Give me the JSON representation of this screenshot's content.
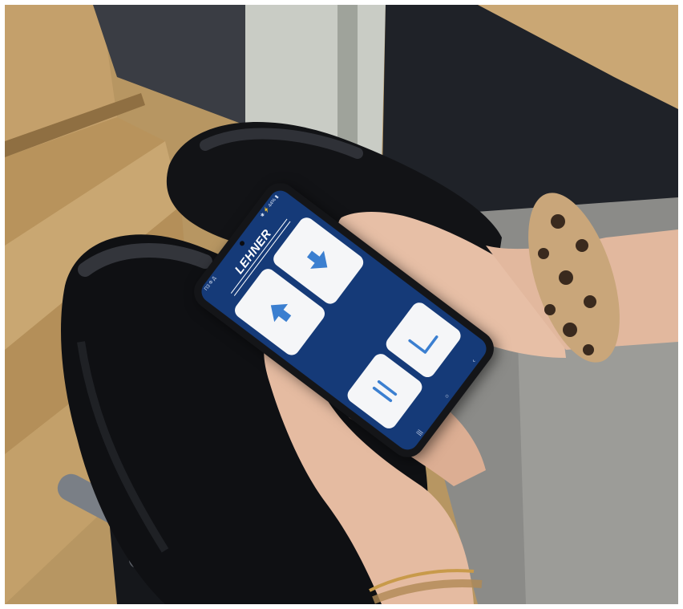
{
  "photo": {
    "description_free": true
  },
  "phone": {
    "status_left": "ПЗ Ф Д",
    "status_right": "✱ ⚡ 44% ▮",
    "logo_text": "LEHNER",
    "keys": {
      "up_icon": "arrow-up-icon",
      "down_icon": "arrow-down-icon",
      "stand_icon": "standing-posture-icon",
      "sit_icon": "sitting-posture-icon"
    },
    "nav": {
      "recents": "|||",
      "home": "○",
      "back": "‹"
    }
  },
  "colors": {
    "screen": "#153a78",
    "key": "#f5f6f8",
    "icon": "#3b7fd0",
    "phone_body": "#141518"
  }
}
